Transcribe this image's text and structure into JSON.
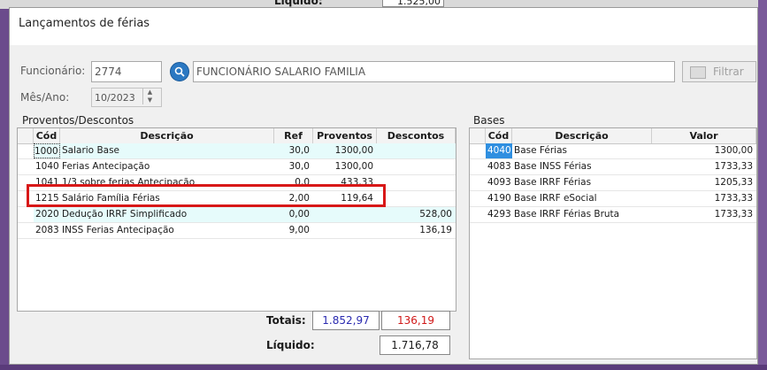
{
  "background": {
    "liquido_label": "Líquido:",
    "liquido_value": "1.525,00"
  },
  "window": {
    "title": "Lançamentos de férias"
  },
  "form": {
    "funcionario_label": "Funcionário:",
    "funcionario_code": "2774",
    "funcionario_name": "FUNCIONÁRIO SALARIO FAMILIA",
    "mesano_label": "Mês/Ano:",
    "mesano_value": "10/2023",
    "filtrar_label": "Filtrar"
  },
  "proventos": {
    "group_label": "Proventos/Descontos",
    "columns": [
      "Cód",
      "Descrição",
      "Ref",
      "Proventos",
      "Descontos"
    ],
    "rows": [
      {
        "cod": "1000",
        "descricao": "Salario Base",
        "ref": "30,0",
        "proventos": "1300,00",
        "descontos": ""
      },
      {
        "cod": "1040",
        "descricao": "Ferias Antecipação",
        "ref": "30,0",
        "proventos": "1300,00",
        "descontos": ""
      },
      {
        "cod": "1041",
        "descricao": "1/3 sobre ferias Antecipação",
        "ref": "0,0",
        "proventos": "433,33",
        "descontos": ""
      },
      {
        "cod": "1215",
        "descricao": "Salário Família Férias",
        "ref": "2,00",
        "proventos": "119,64",
        "descontos": ""
      },
      {
        "cod": "2020",
        "descricao": "Dedução IRRF Simplificado",
        "ref": "0,00",
        "proventos": "",
        "descontos": "528,00"
      },
      {
        "cod": "2083",
        "descricao": "INSS Ferias Antecipação",
        "ref": "9,00",
        "proventos": "",
        "descontos": "136,19"
      }
    ]
  },
  "bases": {
    "group_label": "Bases",
    "columns": [
      "Cód",
      "Descrição",
      "Valor"
    ],
    "rows": [
      {
        "cod": "4040",
        "descricao": "Base Férias",
        "valor": "1300,00"
      },
      {
        "cod": "4083",
        "descricao": "Base INSS Férias",
        "valor": "1733,33"
      },
      {
        "cod": "4093",
        "descricao": "Base IRRF Férias",
        "valor": "1205,33"
      },
      {
        "cod": "4190",
        "descricao": "Base IRRF eSocial",
        "valor": "1733,33"
      },
      {
        "cod": "4293",
        "descricao": "Base IRRF Férias Bruta",
        "valor": "1733,33"
      }
    ]
  },
  "totals": {
    "totais_label": "Totais:",
    "proventos_total": "1.852,97",
    "descontos_total": "136,19",
    "liquido_label": "Líquido:",
    "liquido_value": "1.716,78"
  },
  "colors": {
    "proventos_total": "#2a2ab0",
    "descontos_total": "#d01818",
    "highlight_border": "#d81818",
    "selected": "#2f8fe0"
  }
}
